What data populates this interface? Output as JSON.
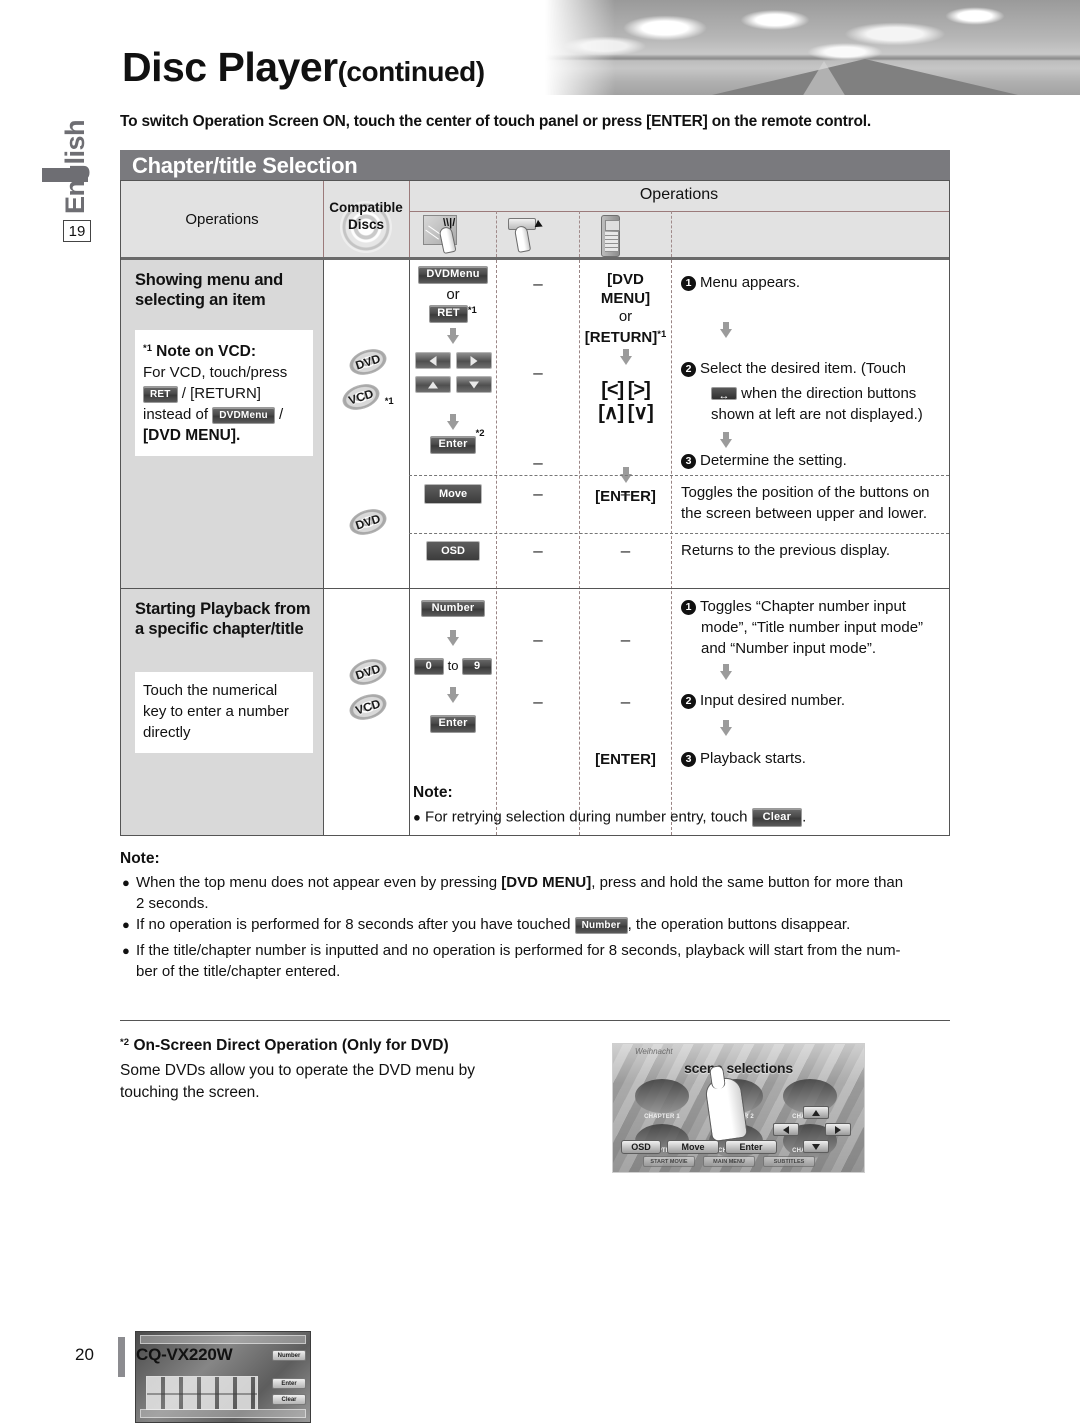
{
  "header": {
    "title_main": "Disc Player",
    "title_cont": "(continued)",
    "side_tab": "English",
    "page_chip": "19",
    "intro": "To switch Operation Screen ON, touch the center of touch panel or press [ENTER] on the remote control."
  },
  "section": {
    "band_title": "Chapter/title Selection"
  },
  "table": {
    "head": {
      "col_operations": "Operations",
      "col_discs_line1": "Compatible",
      "col_discs_line2": "Discs",
      "col_operations_group": "Operations",
      "icon_touch": "touch-panel-icon",
      "icon_button": "button-press-icon",
      "icon_remote": "remote-control-icon"
    },
    "row1": {
      "title": "Showing menu and selecting an item",
      "note_star": "*1",
      "note_title": "Note on VCD:",
      "note_l1": "For VCD, touch/press",
      "note_btn_ret": "RET",
      "note_l2": "/ [RETURN]",
      "note_l3": "instead of",
      "note_btn_dvdmenu": "DVDMenu",
      "note_l4": "/",
      "note_l5": "[DVD MENU].",
      "discs": [
        "DVD",
        "VCD"
      ],
      "discs_star": "*1",
      "panel_btn_dvdmenu": "DVDMenu",
      "panel_or": "or",
      "panel_btn_ret": "RET",
      "panel_ret_star": "*1",
      "panel_btn_enter": "Enter",
      "panel_enter_star": "*2",
      "button_col": [
        "–",
        "–",
        "–"
      ],
      "remote_1": "[DVD MENU]",
      "remote_or": "or",
      "remote_2": "[RETURN]",
      "remote_2_star": "*1",
      "remote_arrows_1": "[<] [>]",
      "remote_arrows_2": "[∧] [∨]",
      "remote_3": "[ENTER]",
      "step1": "Menu appears.",
      "step2a": "Select the desired item. (Touch",
      "step2b": "when the direction buttons",
      "step2c": "shown at left are not displayed.)",
      "step3": "Determine the setting."
    },
    "row2": {
      "disc": "DVD",
      "btn_move": "Move",
      "move_dash1": "–",
      "move_dash2": "–",
      "move_desc_l1": "Toggles the position of the buttons on",
      "move_desc_l2": "the screen between upper and lower.",
      "btn_osd": "OSD",
      "osd_dash1": "–",
      "osd_dash2": "–",
      "osd_desc": "Returns to the previous display."
    },
    "row3": {
      "title": "Starting Playback from a specific chapter/title",
      "note_l1": "Touch the numerical",
      "note_l2": "key to enter a number",
      "note_l3": "directly",
      "discs": [
        "DVD",
        "VCD"
      ],
      "btn_number": "Number",
      "btn_zero": "0",
      "to_word": "to",
      "btn_nine": "9",
      "btn_enter": "Enter",
      "dash1": "–",
      "dash2": "–",
      "remote_enter": "[ENTER]",
      "step1a": "Toggles “Chapter number input",
      "step1b": "mode”, “Title number input mode”",
      "step1c": "and “Number input mode”.",
      "step2": "Input desired number.",
      "step3": "Playback starts.",
      "note_hdr": "Note:",
      "note_text_a": "For retrying selection during number entry, touch",
      "btn_clear": "Clear",
      "note_text_b": "."
    }
  },
  "notes": {
    "header": "Note:",
    "items": [
      {
        "pre": "When the top menu does not appear even by pressing ",
        "bold": "[DVD MENU]",
        "post": ", press and hold the same button for more than",
        "line2": "2 seconds."
      },
      {
        "pre": "If no operation is performed for 8 seconds after you have touched ",
        "btn": "Number",
        "post": ", the operation buttons disappear.",
        "line2": ""
      },
      {
        "pre": "If the title/chapter number is inputted and no operation is performed for 8 seconds, playback will start from the num-",
        "bold": "",
        "post": "",
        "line2": "ber of the title/chapter entered."
      }
    ]
  },
  "onscreen": {
    "star": "*2",
    "heading": "On-Screen Direct Operation (Only for DVD)",
    "body_l1": "Some DVDs allow you to operate the DVD menu by",
    "body_l2": "touching the screen.",
    "shot": {
      "watermark": "Weihnacht",
      "title": "scene selections",
      "chapters": [
        "CHAPTER 1",
        "CHAPTER 2",
        "CHAPTER 3",
        "CHAPTER 4",
        "CHAPTER 5",
        "CHAPTER 6"
      ],
      "buttons": [
        "OSD",
        "Move",
        "Enter"
      ],
      "grey_buttons": [
        "START MOVIE",
        "MAIN MENU",
        "SUBTITLES"
      ]
    }
  },
  "footer": {
    "page": "20",
    "model": "CQ-VX220W"
  }
}
